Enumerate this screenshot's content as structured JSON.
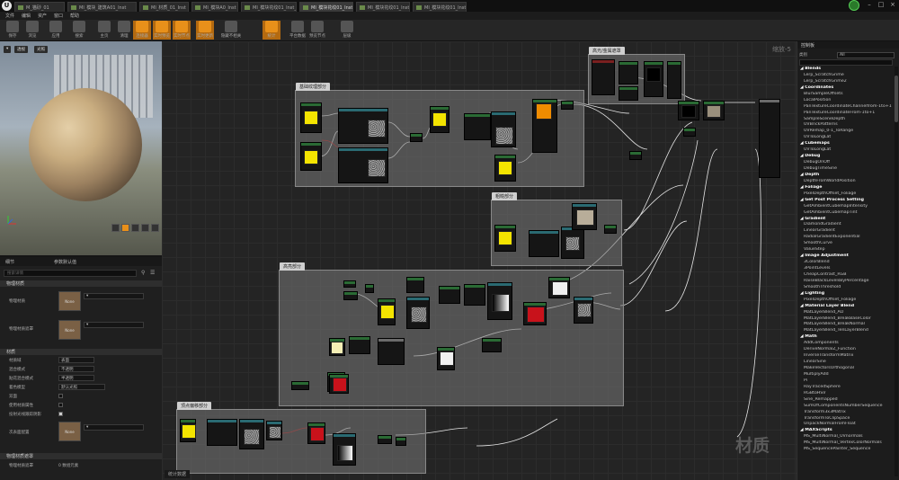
{
  "tabs": [
    {
      "label": "M_猫砂_01",
      "active": false
    },
    {
      "label": "MI_模块_建筑A01_Inst",
      "active": false
    },
    {
      "label": "MI_材质_01_Inst",
      "active": false
    },
    {
      "label": "MI_模块A0_Inst",
      "active": false
    },
    {
      "label": "MI_模块花纹01_Inst_2",
      "active": false
    },
    {
      "label": "MI_模块花纹01_Inst_3",
      "active": true
    },
    {
      "label": "MI_模块花纹01_Inst_3",
      "active": false
    },
    {
      "label": "MI_模块花纹01_Inst_4",
      "active": false
    }
  ],
  "menu": [
    "文件",
    "编辑",
    "资产",
    "窗口",
    "帮助"
  ],
  "toolbar": [
    {
      "label": "保存",
      "active": false
    },
    {
      "label": "浏览",
      "active": false
    },
    {
      "label": "应用",
      "active": false
    },
    {
      "label": "搜索",
      "active": false
    },
    {
      "label": "主页",
      "active": false
    },
    {
      "label": "清理",
      "active": false
    },
    {
      "label": "连接器",
      "active": true
    },
    {
      "label": "实时预览",
      "active": true
    },
    {
      "label": "实时节点",
      "active": true
    },
    {
      "label": "实时更新",
      "active": true
    },
    {
      "label": "隐藏不相关",
      "active": false
    },
    {
      "label": "统计",
      "active": true
    },
    {
      "label": "平台数据",
      "active": false
    },
    {
      "label": "预览节点",
      "active": false
    },
    {
      "label": "层级",
      "active": false
    }
  ],
  "viewport": {
    "mode_label": "透视",
    "lit_label": "光照"
  },
  "details": {
    "tab_details": "细节",
    "tab_params": "参数默认值",
    "search_placeholder": "搜索详情",
    "section_physics": "物理材质",
    "physics_label": "物理材质",
    "physics_mask_label": "物理材质遮罩",
    "swatch_none": "None",
    "section_material": "材质",
    "props": [
      {
        "label": "材质域",
        "value": "表面"
      },
      {
        "label": "混合模式",
        "value": "不透明"
      },
      {
        "label": "贴花混合模式",
        "value": "半透明"
      },
      {
        "label": "着色模型",
        "value": "默认光照"
      },
      {
        "label": "双面",
        "value": ""
      },
      {
        "label": "使用材质属性",
        "value": ""
      },
      {
        "label": "投射光线跟踪阴影",
        "value": ""
      }
    ],
    "subsurface_label": "次表面配置",
    "section_physics_mask": "物理材质遮罩",
    "physics_mask_footer_label": "物理材质遮罩",
    "physics_mask_footer_value": "0 数组元素"
  },
  "graph": {
    "zoom": "缩放-5",
    "watermark": "材质",
    "stats_tab": "统计数据",
    "comments": [
      "基础纹理部分",
      "高光/金属遮罩",
      "粗糙部分",
      "高亮部分",
      "顶点偏移部分"
    ]
  },
  "palette": {
    "title": "控制板",
    "filter_label": "类别",
    "filter_value": "All",
    "items": [
      {
        "t": "Blends",
        "cat": true
      },
      {
        "t": "Lerp_ScratchGrime",
        "cat": false
      },
      {
        "t": "Lerp_ScratchGrime2",
        "cat": false
      },
      {
        "t": "Coordinates",
        "cat": true
      },
      {
        "t": "BlurSampleOffsets",
        "cat": false
      },
      {
        "t": "LocalPosition",
        "cat": false
      },
      {
        "t": "PanTextureCoordinateChannelfrom-1to+1",
        "cat": false
      },
      {
        "t": "PanTextureCoordinateFrom-1to+1",
        "cat": false
      },
      {
        "t": "SampleSceneDepth",
        "cat": false
      },
      {
        "t": "UVBrickPatterns",
        "cat": false
      },
      {
        "t": "UVRemap_0-1_ToRange",
        "cat": false
      },
      {
        "t": "UVToLongLat",
        "cat": false
      },
      {
        "t": "Cubemaps",
        "cat": true
      },
      {
        "t": "UVToLongLat",
        "cat": false
      },
      {
        "t": "Debug",
        "cat": true
      },
      {
        "t": "DebugOnOff",
        "cat": false
      },
      {
        "t": "DebugTimeSine",
        "cat": false
      },
      {
        "t": "Depth",
        "cat": true
      },
      {
        "t": "DepthFromWorldPosition",
        "cat": false
      },
      {
        "t": "Foliage",
        "cat": true
      },
      {
        "t": "PixelDepthOffset_Foliage",
        "cat": false
      },
      {
        "t": "Get Post Process Setting",
        "cat": true
      },
      {
        "t": "GetAmbientCubemapIntensity",
        "cat": false
      },
      {
        "t": "GetAmbientCubemapTint",
        "cat": false
      },
      {
        "t": "Gradient",
        "cat": true
      },
      {
        "t": "DiamondGradient",
        "cat": false
      },
      {
        "t": "LinearGradient",
        "cat": false
      },
      {
        "t": "RadialGradientExponential",
        "cat": false
      },
      {
        "t": "SmoothCurve",
        "cat": false
      },
      {
        "t": "ValueStep",
        "cat": false
      },
      {
        "t": "Image Adjustment",
        "cat": true
      },
      {
        "t": "3ColorBlend",
        "cat": false
      },
      {
        "t": "3PointLevels",
        "cat": false
      },
      {
        "t": "CheapContrast_RGB",
        "cat": false
      },
      {
        "t": "RaiseBlackLevelsByPercentage",
        "cat": false
      },
      {
        "t": "SmoothThreshold",
        "cat": false
      },
      {
        "t": "Lighting",
        "cat": true
      },
      {
        "t": "PixelDepthOffset_Foliage",
        "cat": false
      },
      {
        "t": "Material Layer Blend",
        "cat": true
      },
      {
        "t": "MatLayerBlend_AO",
        "cat": false
      },
      {
        "t": "MatLayerBlend_BreakBaseColor",
        "cat": false
      },
      {
        "t": "MatLayerBlend_BreakNormal",
        "cat": false
      },
      {
        "t": "MatLayerBlend_TenLayerBlend",
        "cat": false
      },
      {
        "t": "Math",
        "cat": true
      },
      {
        "t": "AddComponents",
        "cat": false
      },
      {
        "t": "DeriveNormalZ_Function",
        "cat": false
      },
      {
        "t": "InverseTransformMatrix",
        "cat": false
      },
      {
        "t": "LinearSine",
        "cat": false
      },
      {
        "t": "MakeVectorsOrthogonal",
        "cat": false
      },
      {
        "t": "MultiplyAdd",
        "cat": false
      },
      {
        "t": "Pi",
        "cat": false
      },
      {
        "t": "RayTracedSphere",
        "cat": false
      },
      {
        "t": "RGBtoHSV",
        "cat": false
      },
      {
        "t": "Sine_Remapped",
        "cat": false
      },
      {
        "t": "SumOfComponentsNumberSequence",
        "cat": false
      },
      {
        "t": "Transform3x3Matrix",
        "cat": false
      },
      {
        "t": "TransformToClipSpace",
        "cat": false
      },
      {
        "t": "UnpackNormalFromFloat",
        "cat": false
      },
      {
        "t": "MAXScripts",
        "cat": true
      },
      {
        "t": "MS_MultiNormal_UVnormals",
        "cat": false
      },
      {
        "t": "MS_MultiNormal_VertexColorNormals",
        "cat": false
      },
      {
        "t": "MS_SequencePainter_Sequence",
        "cat": false
      }
    ]
  },
  "colors": {
    "accent": "#e8901a",
    "node_yellow": "#f4e400",
    "node_red": "#c8121b"
  }
}
